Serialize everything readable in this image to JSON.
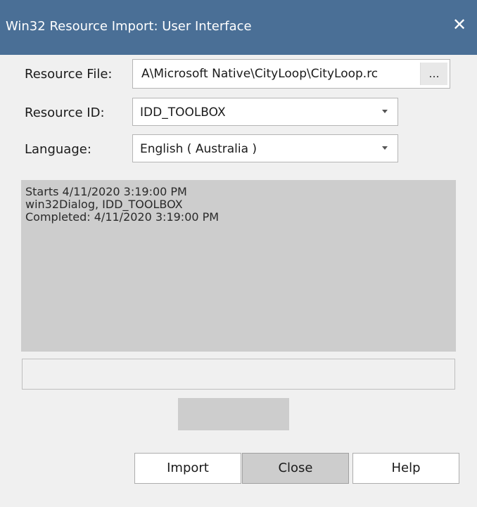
{
  "window": {
    "title": "Win32 Resource Import: User Interface",
    "close_glyph": "✕",
    "titlebar_color": "#4a6f96"
  },
  "form": {
    "resource_file": {
      "label": "Resource File:",
      "value": "A\\Microsoft Native\\CityLoop\\CityLoop.rc",
      "browse_label": "..."
    },
    "resource_id": {
      "label": "Resource ID:",
      "value": "IDD_TOOLBOX"
    },
    "language": {
      "label": "Language:",
      "value": "English ( Australia )"
    }
  },
  "log": {
    "lines": [
      "Starts 4/11/2020 3:19:00 PM",
      "win32Dialog, IDD_TOOLBOX",
      "Completed: 4/11/2020 3:19:00 PM"
    ]
  },
  "progress": {
    "fraction": 0
  },
  "buttons": {
    "import": "Import",
    "close": "Close",
    "help": "Help"
  }
}
